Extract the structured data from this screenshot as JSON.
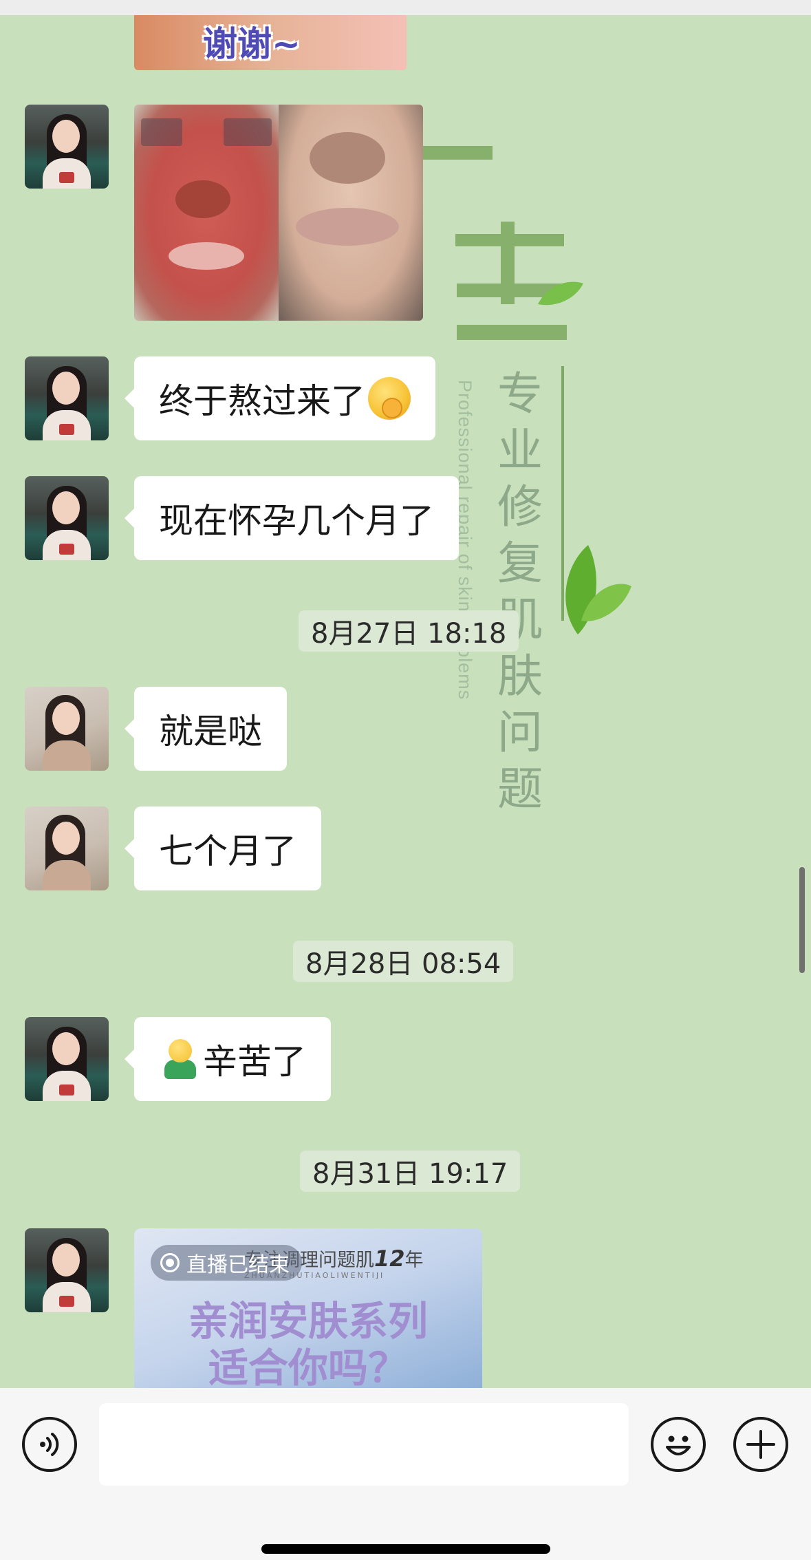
{
  "chat": {
    "sticker_text": "谢谢~",
    "messages": [
      {
        "type": "image",
        "sender": "contact",
        "description_icon": "skin-comparison-photo"
      },
      {
        "type": "text",
        "sender": "contact",
        "text": "终于熬过来了",
        "emoji": "face-with-hand-over-mouth"
      },
      {
        "type": "text",
        "sender": "contact",
        "text": "现在怀孕几个月了"
      },
      {
        "type": "time",
        "text": "8月27日 18:18"
      },
      {
        "type": "text",
        "sender": "self",
        "text": "就是哒"
      },
      {
        "type": "text",
        "sender": "self",
        "text": "七个月了"
      },
      {
        "type": "time",
        "text": "8月28日 08:54"
      },
      {
        "type": "text",
        "sender": "contact",
        "text": "辛苦了",
        "emoji": "person-shrugging"
      },
      {
        "type": "time",
        "text": "8月31日 19:17"
      },
      {
        "type": "live-card",
        "sender": "contact"
      }
    ],
    "live_card": {
      "status": "直播已结束",
      "brand": "专注调理问题肌",
      "brand_years": "12",
      "brand_unit": "年",
      "brand_pinyin": "ZHUANZHUTIAOLIWENTIJI",
      "title_line1": "亲润安肤系列",
      "title_line2": "适合你吗？"
    }
  },
  "watermark": {
    "cn": [
      "专",
      "业",
      "修",
      "复",
      "肌",
      "肤",
      "问",
      "题"
    ],
    "en": "Professional repair of skin problems"
  },
  "input_bar": {
    "voice_icon": "voice-icon",
    "emoji_icon": "smiley-icon",
    "plus_icon": "plus-icon",
    "value": ""
  },
  "colors": {
    "background": "#c8e0bb",
    "bubble": "#ffffff",
    "timestamp_bg": "#dbe8d3",
    "input_bar": "#f6f6f6"
  }
}
